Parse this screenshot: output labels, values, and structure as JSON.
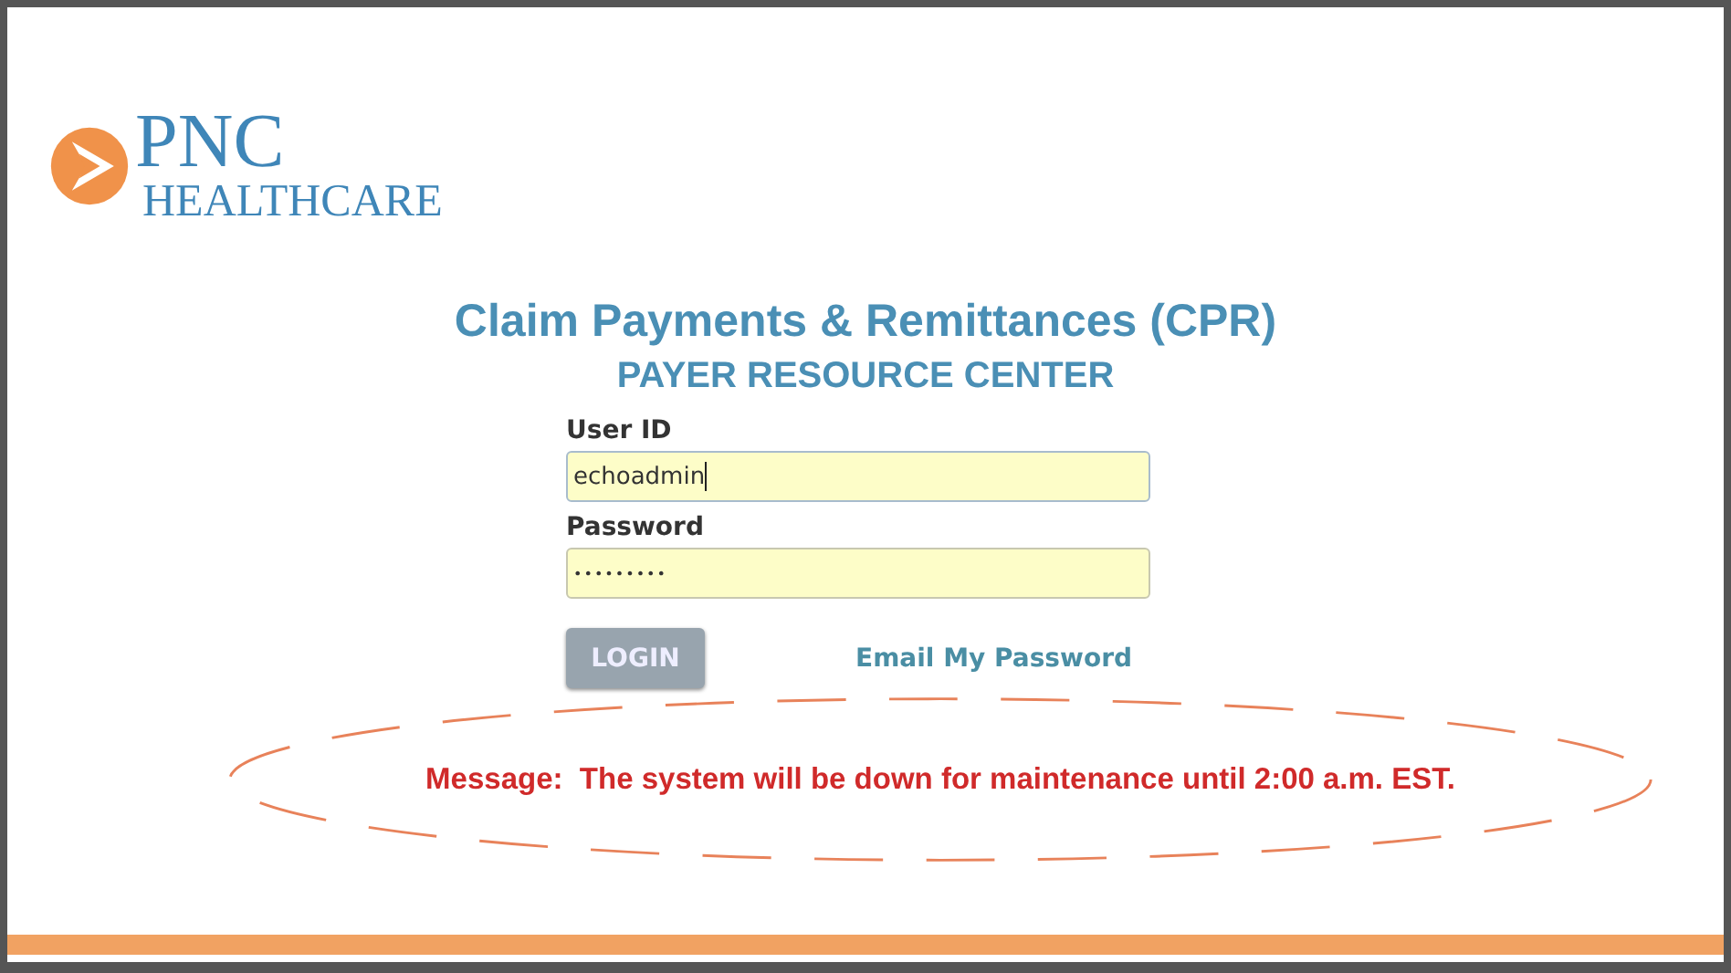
{
  "logo": {
    "brand": "PNC",
    "subtitle": "HEALTHCARE"
  },
  "title": "Claim Payments & Remittances (CPR)",
  "subtitle": "PAYER RESOURCE CENTER",
  "fields": [
    {
      "label": "User ID",
      "value": "echoadmin",
      "focused": true
    },
    {
      "label": "Password",
      "value": "•••••••••",
      "focused": false
    }
  ],
  "login_button": "LOGIN",
  "email_link": "Email My Password",
  "message": "Message:  The system will be down for maintenance until 2:00 a.m. EST."
}
